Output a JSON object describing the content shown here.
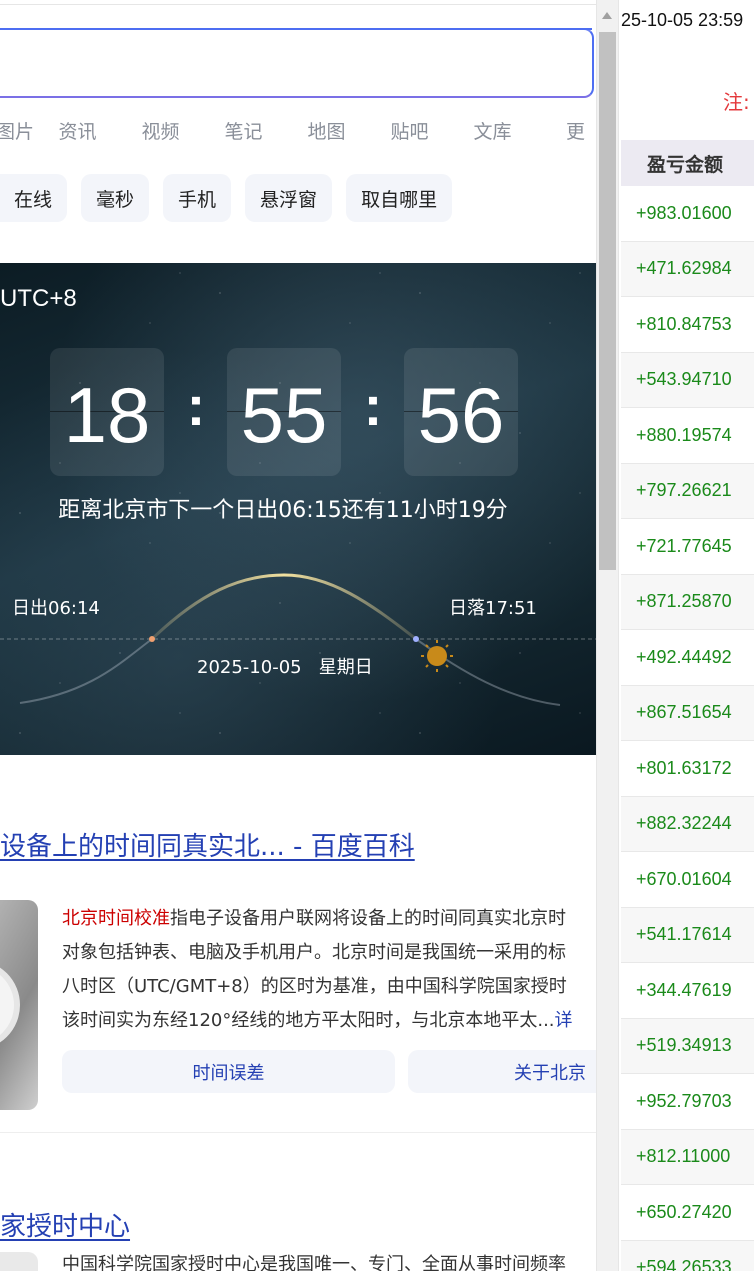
{
  "nav_tabs": [
    "图片",
    "资讯",
    "视频",
    "笔记",
    "地图",
    "贴吧",
    "文库",
    "更"
  ],
  "chips": [
    "在线",
    "毫秒",
    "手机",
    "悬浮窗",
    "取自哪里"
  ],
  "clock": {
    "timezone": "UTC+8",
    "hours": "18",
    "minutes": "55",
    "seconds": "56",
    "colon": ":",
    "sunrise_message": "距离北京市下一个日出06:15还有11小时19分",
    "sunrise": "日出06:14",
    "sunset": "日落17:51",
    "date": "2025-10-05   星期日"
  },
  "result1": {
    "title": "设备上的时间同真实北... - 百度百科",
    "snippet_highlight": "北京时间校准",
    "snippet_line1": "指电子设备用户联网将设备上的时间同真实北京时",
    "snippet_line2": "对象包括钟表、电脑及手机用户。北京时间是我国统一采用的标",
    "snippet_line3": "八时区（UTC/GMT+8）的区时为基准，由中国科学院国家授时",
    "snippet_line4": "该时间实为东经120°经线的地方平太阳时，与北京本地平太...",
    "snippet_more": "详",
    "link1": "时间误差",
    "link2": "关于北京"
  },
  "result2": {
    "title": "家授时中心",
    "snippet": "中国科学院国家授时中心是我国唯一、专门、全面从事时间频率"
  },
  "right_panel": {
    "timestamp": "25-10-05 23:59",
    "note": "注:",
    "column_header": "盈亏金额",
    "amounts": [
      "+983.01600",
      "+471.62984",
      "+810.84753",
      "+543.94710",
      "+880.19574",
      "+797.26621",
      "+721.77645",
      "+871.25870",
      "+492.44492",
      "+867.51654",
      "+801.63172",
      "+882.32244",
      "+670.01604",
      "+541.17614",
      "+344.47619",
      "+519.34913",
      "+952.79703",
      "+812.11000",
      "+650.27420",
      "+594.26533"
    ]
  },
  "colors": {
    "accent_blue": "#4e6ef2",
    "link_blue": "#2440b3",
    "profit_green": "#1a8a1a",
    "note_red": "#e4393c"
  }
}
